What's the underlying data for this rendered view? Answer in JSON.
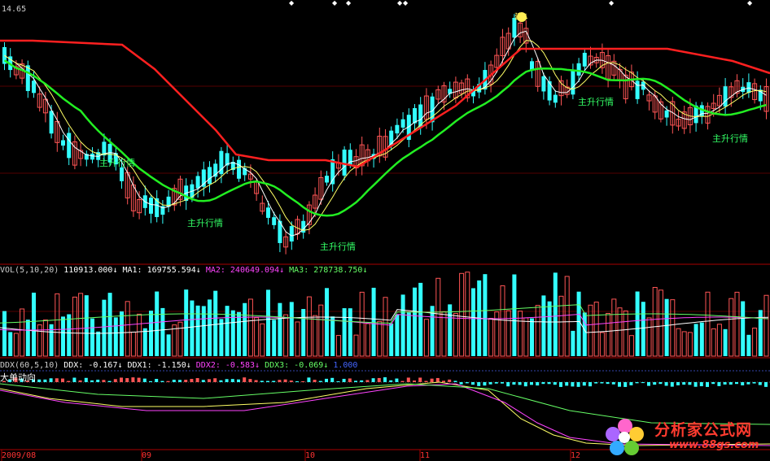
{
  "main_panel": {
    "price_label": "14.65",
    "signal_label": "主升行情",
    "marker_label": "建",
    "colors": {
      "up": "#ff5555",
      "down": "#33ffff",
      "ma_long": "#ff2020",
      "ma_mid": "#22ee22",
      "ma_short1": "#ffff66",
      "ma_short2": "#ffffff"
    }
  },
  "vol_panel": {
    "name": "VOL(5,10,20)",
    "value": "110913.000↓",
    "ma1": "MA1: 169755.594↓",
    "ma2": "MA2: 240649.094↓",
    "ma3": "MA3: 278738.750↓",
    "colors": {
      "name": "#cccccc",
      "ma1": "#ffffff",
      "ma2": "#ff44ff",
      "ma3": "#66ff66"
    }
  },
  "ddx_panel": {
    "name": "DDX(60,5,10)",
    "ddx": "DDX: -0.167↓",
    "ddx1": "DDX1: -1.150↓",
    "ddx2": "DDX2: -0.583↓",
    "ddx3": "DDX3: -0.069↓",
    "ref": "1.000",
    "sub_label": "大单动向",
    "colors": {
      "ddx2": "#ff44ff",
      "ddx3": "#66ff66",
      "ref": "#4466ff"
    }
  },
  "x_axis": {
    "labels": [
      "2009/08",
      "09",
      "10",
      "11",
      "12"
    ],
    "color": "#ff3333"
  },
  "watermark": {
    "title": "分析家公式网",
    "url": "www.88gs.com"
  },
  "chart_data": {
    "type": "candlestick",
    "title": "",
    "x_axis_labels": [
      "2009/08",
      "09",
      "10",
      "11",
      "12"
    ],
    "price_y_label": "14.65",
    "signals": [
      "主升行情",
      "主升行情",
      "主升行情",
      "主升行情",
      "主升行情"
    ],
    "volume_legend": {
      "VOL": 110913.0,
      "MA1": 169755.594,
      "MA2": 240649.094,
      "MA3": 278738.75
    },
    "ddx_legend": {
      "DDX": -0.167,
      "DDX1": -1.15,
      "DDX2": -0.583,
      "DDX3": -0.069,
      "ref": 1.0
    }
  }
}
